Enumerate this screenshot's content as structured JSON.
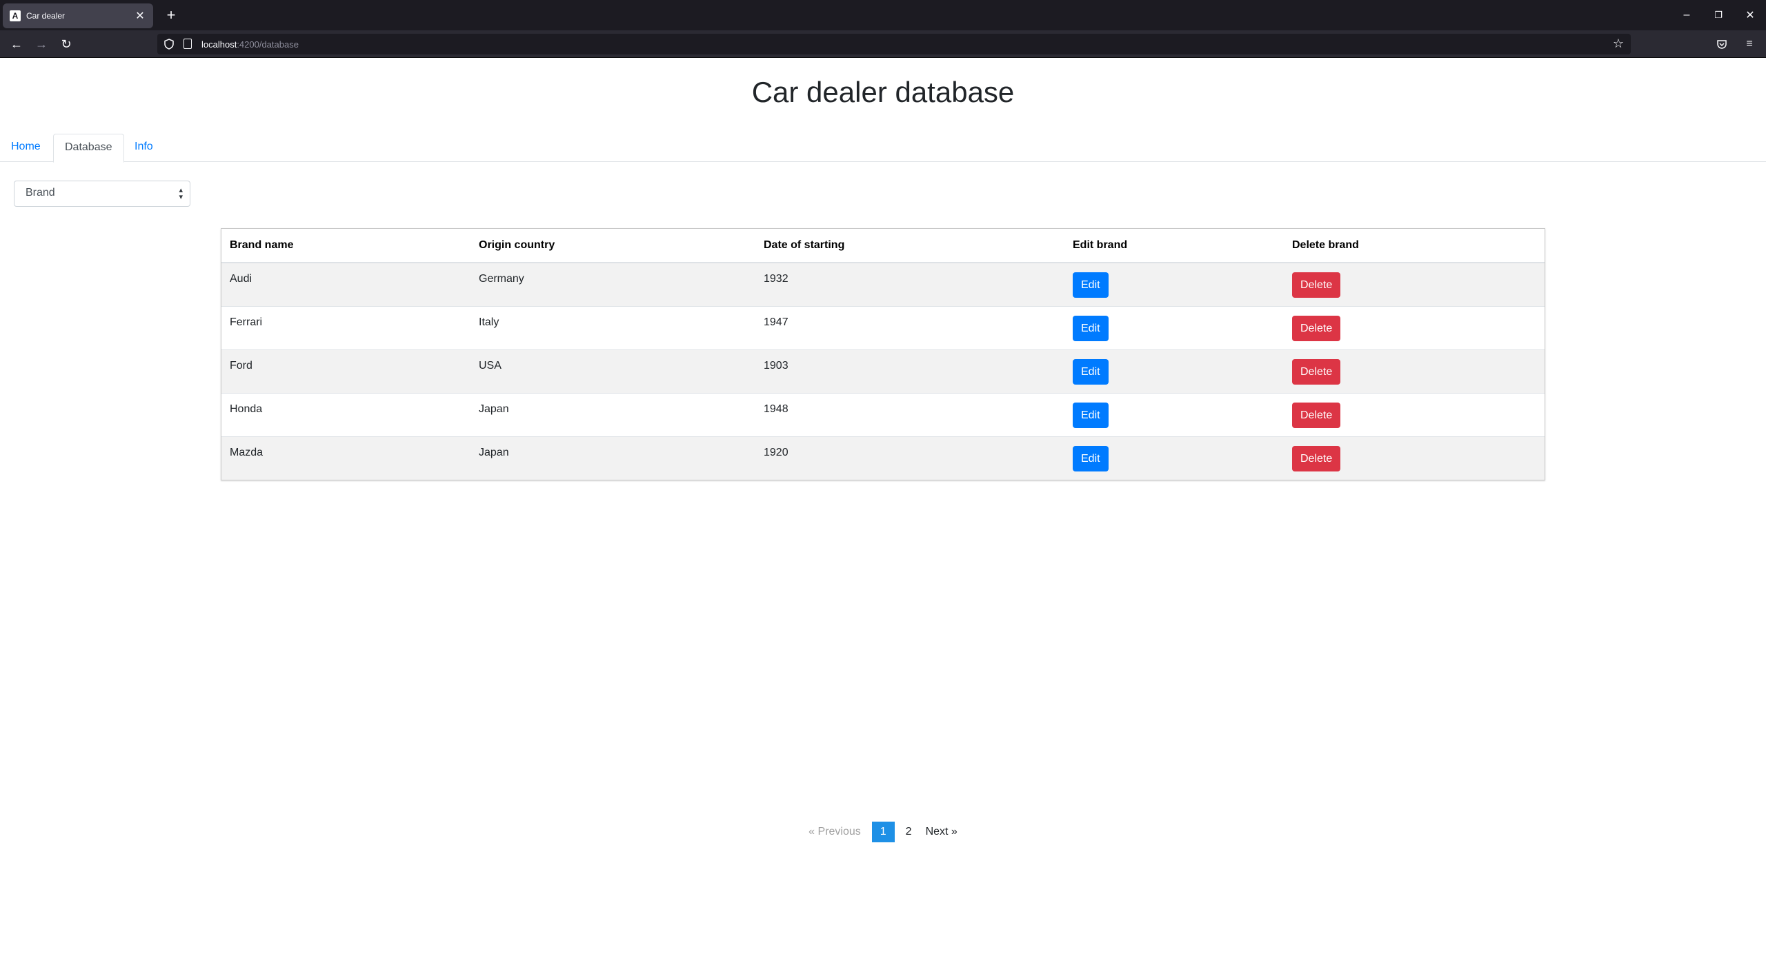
{
  "browser": {
    "tab_title": "Car dealer",
    "tab_favicon": "A",
    "url_host": "localhost",
    "url_path": ":4200/database"
  },
  "page": {
    "title": "Car dealer database"
  },
  "nav": {
    "tabs": [
      {
        "label": "Home",
        "active": false
      },
      {
        "label": "Database",
        "active": true
      },
      {
        "label": "Info",
        "active": false
      }
    ]
  },
  "filter": {
    "selected": "Brand"
  },
  "table": {
    "headers": [
      "Brand name",
      "Origin country",
      "Date of starting",
      "Edit brand",
      "Delete brand"
    ],
    "edit_label": "Edit",
    "delete_label": "Delete",
    "rows": [
      {
        "brand": "Audi",
        "country": "Germany",
        "year": "1932"
      },
      {
        "brand": "Ferrari",
        "country": "Italy",
        "year": "1947"
      },
      {
        "brand": "Ford",
        "country": "USA",
        "year": "1903"
      },
      {
        "brand": "Honda",
        "country": "Japan",
        "year": "1948"
      },
      {
        "brand": "Mazda",
        "country": "Japan",
        "year": "1920"
      }
    ]
  },
  "pagination": {
    "prev_label": "« Previous",
    "pages": [
      "1",
      "2"
    ],
    "current": "1",
    "next_label": "Next »"
  },
  "colors": {
    "primary": "#007bff",
    "danger": "#dc3545",
    "page_active": "#1e90e6"
  }
}
